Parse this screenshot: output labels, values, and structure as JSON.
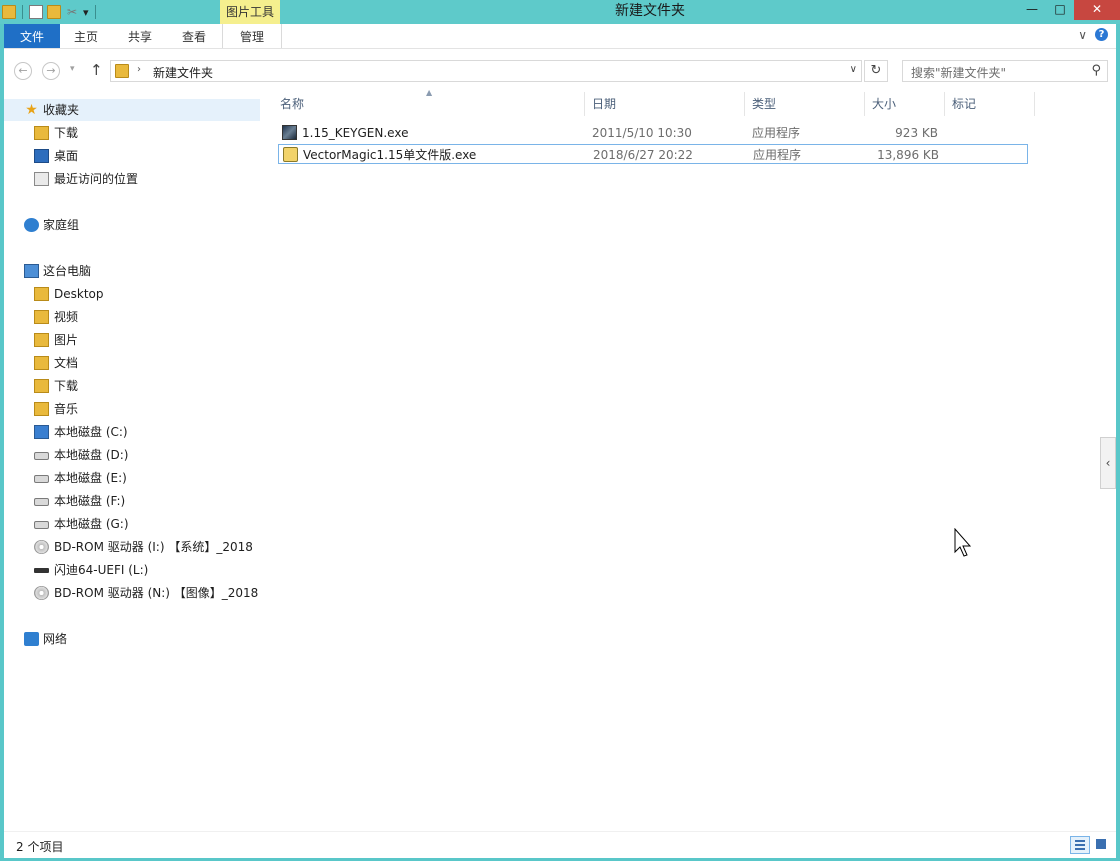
{
  "window": {
    "title": "新建文件夹",
    "context_tab": "图片工具",
    "controls": {
      "minimize": "—",
      "maximize": "□",
      "close": "✕"
    }
  },
  "qat": {
    "dropdown": "▾"
  },
  "ribbon": {
    "tabs": [
      "文件",
      "主页",
      "共享",
      "查看",
      "管理"
    ],
    "expand": "∨",
    "help": "?"
  },
  "address": {
    "back": "←",
    "forward": "→",
    "recent": "▾",
    "up": "↑",
    "separator": "›",
    "path": "新建文件夹",
    "dropdown": "∨",
    "refresh": "↻",
    "search_placeholder": "搜索\"新建文件夹\"",
    "search_icon": "⚲"
  },
  "nav": {
    "favorites": "收藏夹",
    "favorite_items": [
      "下载",
      "桌面",
      "最近访问的位置"
    ],
    "homegroup": "家庭组",
    "this_pc": "这台电脑",
    "pc_items": [
      "Desktop",
      "视频",
      "图片",
      "文档",
      "下载",
      "音乐"
    ],
    "drives": [
      "本地磁盘 (C:)",
      "本地磁盘 (D:)",
      "本地磁盘 (E:)",
      "本地磁盘 (F:)",
      "本地磁盘 (G:)",
      "BD-ROM 驱动器 (I:) 【系统】_2018",
      "闪迪64-UEFI (L:)",
      "BD-ROM 驱动器 (N:) 【图像】_2018"
    ],
    "network": "网络"
  },
  "list": {
    "sort_indicator": "▲",
    "columns": {
      "name": "名称",
      "date": "日期",
      "type": "类型",
      "size": "大小",
      "tags": "标记"
    },
    "files": [
      {
        "name": "1.15_KEYGEN.exe",
        "date": "2011/5/10 10:30",
        "type": "应用程序",
        "size": "923 KB"
      },
      {
        "name": "VectorMagic1.15单文件版.exe",
        "date": "2018/6/27 20:22",
        "type": "应用程序",
        "size": "13,896 KB"
      }
    ]
  },
  "side_handle": "‹",
  "status": {
    "count": "2 个项目"
  }
}
